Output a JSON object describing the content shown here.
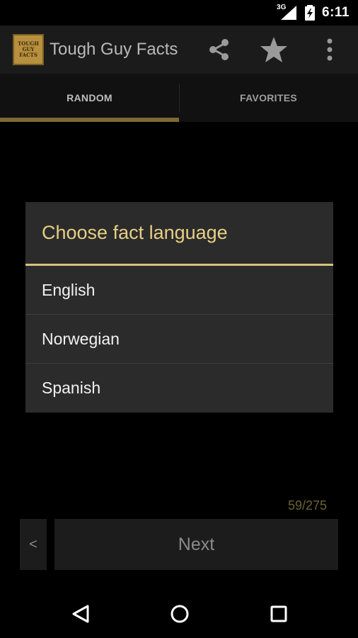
{
  "status_bar": {
    "network": "3G",
    "time": "6:11"
  },
  "app_bar": {
    "logo_text": [
      "TOUGH",
      "GUY",
      "FACTS"
    ],
    "title": "Tough Guy Facts"
  },
  "tabs": [
    {
      "label": "RANDOM"
    },
    {
      "label": "FAVORITES"
    }
  ],
  "dialog": {
    "title": "Choose fact language",
    "options": [
      "English",
      "Norwegian",
      "Spanish"
    ]
  },
  "footer": {
    "counter": "59/275",
    "prev_label": "<",
    "next_label": "Next"
  },
  "colors": {
    "accent": "#e6cf84",
    "tab_indicator": "#7c6933",
    "logo": "#b8903e"
  }
}
